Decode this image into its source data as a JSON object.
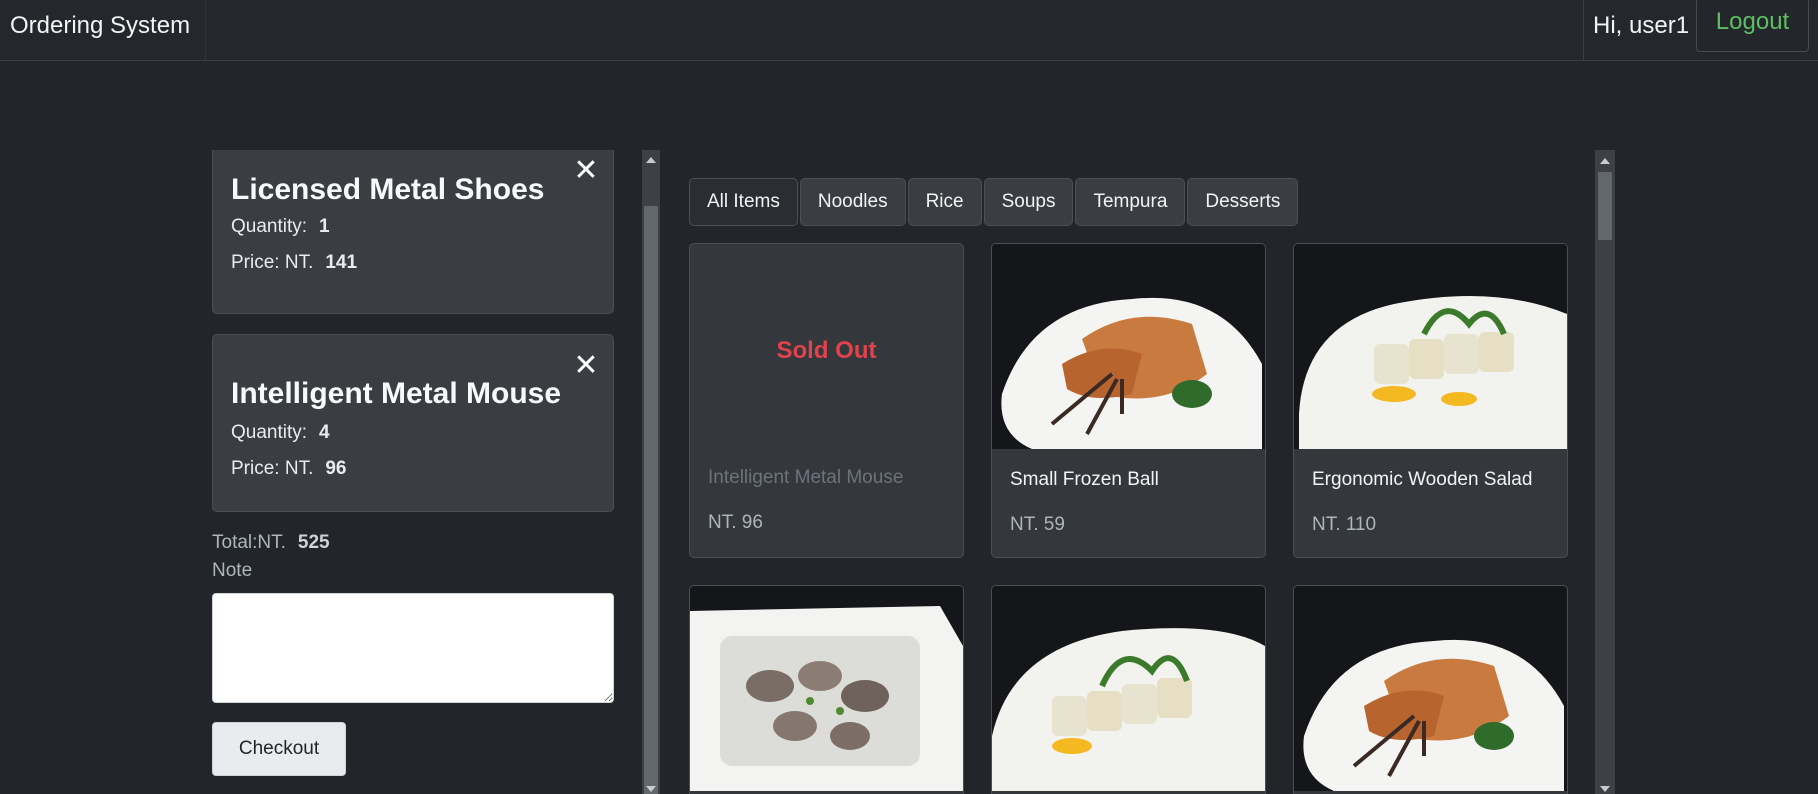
{
  "navbar": {
    "brand": "Ordering System",
    "greeting": "Hi, user1",
    "logout_label": "Logout"
  },
  "cart": {
    "items": [
      {
        "name": "Licensed Metal Shoes",
        "quantity_label": "Quantity:",
        "quantity": "1",
        "price_label": "Price: NT.",
        "price": "141",
        "remove_icon": "close-icon"
      },
      {
        "name": "Intelligent Metal Mouse",
        "quantity_label": "Quantity:",
        "quantity": "4",
        "price_label": "Price: NT.",
        "price": "96",
        "remove_icon": "close-icon"
      }
    ],
    "total_label": "Total:NT.",
    "total": "525",
    "note_label": "Note",
    "note_value": "",
    "checkout_label": "Checkout"
  },
  "menu": {
    "tabs": [
      {
        "label": "All Items",
        "active": true
      },
      {
        "label": "Noodles"
      },
      {
        "label": "Rice"
      },
      {
        "label": "Soups"
      },
      {
        "label": "Tempura"
      },
      {
        "label": "Desserts"
      }
    ],
    "products": [
      {
        "name": "Intelligent Metal Mouse",
        "price": "NT. 96",
        "status": "Sold Out"
      },
      {
        "name": "Small Frozen Ball",
        "price": "NT. 59",
        "image": "grilled-eel-photo"
      },
      {
        "name": "Ergonomic Wooden Salad",
        "price": "NT. 110",
        "image": "sushi-roll-photo"
      },
      {
        "image": "clams-photo"
      },
      {
        "image": "sushi-roll-photo"
      },
      {
        "image": "grilled-eel-photo"
      }
    ]
  },
  "colors": {
    "background": "#222529",
    "card": "#3a3d41",
    "logout_text": "#5cbf63",
    "sold_out": "#e0434b"
  }
}
